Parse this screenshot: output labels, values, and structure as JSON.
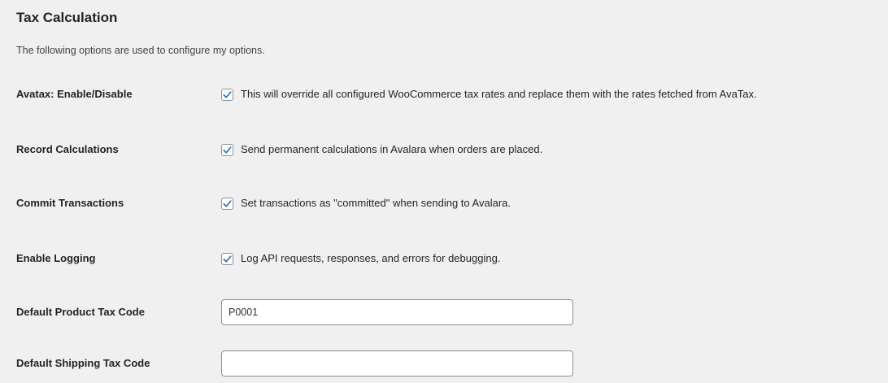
{
  "section": {
    "title": "Tax Calculation",
    "description": "The following options are used to configure my options."
  },
  "fields": {
    "enable": {
      "label": "Avatax: Enable/Disable",
      "checked": true,
      "description": "This will override all configured WooCommerce tax rates and replace them with the rates fetched from AvaTax."
    },
    "record_calculations": {
      "label": "Record Calculations",
      "checked": true,
      "description": "Send permanent calculations in Avalara when orders are placed."
    },
    "commit_transactions": {
      "label": "Commit Transactions",
      "checked": true,
      "description": "Set transactions as \"committed\" when sending to Avalara."
    },
    "enable_logging": {
      "label": "Enable Logging",
      "checked": true,
      "description": "Log API requests, responses, and errors for debugging."
    },
    "default_product_tax_code": {
      "label": "Default Product Tax Code",
      "value": "P0001",
      "placeholder": ""
    },
    "default_shipping_tax_code": {
      "label": "Default Shipping Tax Code",
      "value": "",
      "placeholder": ""
    }
  },
  "colors": {
    "background": "#f0f0f1",
    "checkmark": "#2271b1",
    "border": "#8c8f94"
  }
}
